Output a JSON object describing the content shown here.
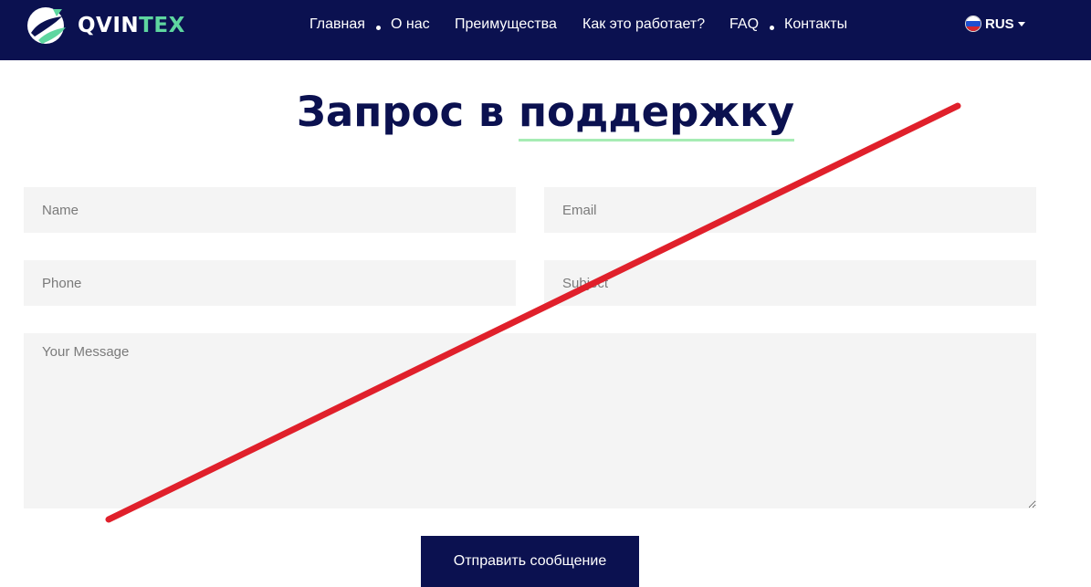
{
  "brand": {
    "name_main": "QVIN",
    "name_accent": "TEX"
  },
  "nav": {
    "items": [
      "Главная",
      "О нас",
      "Преимущества",
      "Как это работает?",
      "FAQ",
      "Контакты"
    ]
  },
  "language": {
    "label": "RUS",
    "flag_icon": "russia-flag-icon"
  },
  "page": {
    "heading_part1": "Запрос в ",
    "heading_highlight": "поддержку"
  },
  "form": {
    "name_placeholder": "Name",
    "email_placeholder": "Email",
    "phone_placeholder": "Phone",
    "subject_placeholder": "Subject",
    "message_placeholder": "Your Message",
    "submit_label": "Отправить сообщение"
  },
  "colors": {
    "navbar": "#0b1150",
    "accent_green": "#5ed6a0",
    "underline": "#a6ecb4",
    "field_bg": "#f4f4f4",
    "strike_line": "#e0202b"
  }
}
